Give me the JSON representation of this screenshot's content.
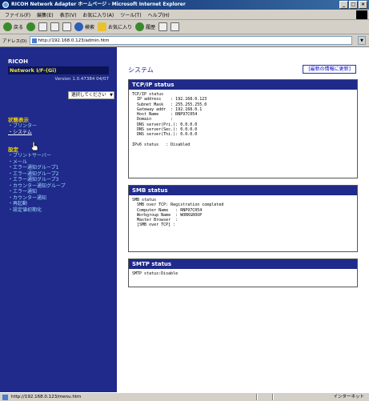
{
  "window": {
    "title": "RICOH Network Adapter ホームページ - Microsoft Internet Explorer"
  },
  "menu": [
    "ファイル(F)",
    "編集(E)",
    "表示(V)",
    "お気に入り(A)",
    "ツール(T)",
    "ヘルプ(H)"
  ],
  "toolbar": {
    "back": "戻る",
    "search": "検索",
    "favorites": "お気に入り",
    "history": "履歴"
  },
  "address": {
    "label": "アドレス(D)",
    "url": "http://192.168.0.123/admin.htm"
  },
  "sidebar": {
    "product": "RICOH",
    "network": "Network I/F-(Gi)",
    "version": "Version 1.0.47384 04/07",
    "select_label": "選択してください",
    "status_section": "状態表示",
    "status_links": [
      "・プリンター",
      "・システム"
    ],
    "settings_section": "設定",
    "settings_links": [
      "・プリントサーバー",
      "・メール",
      "・エラー通知グループ1",
      "・エラー通知グループ2",
      "・エラー通知グループ3",
      "・カウンター通知グループ",
      "・エラー通知",
      "・カウンター通知",
      "・再起動",
      "・設定値初期化"
    ]
  },
  "main": {
    "title": "システム",
    "refresh_button": "[最新の情報に更新]",
    "panels": [
      {
        "title": "TCP/IP status",
        "body": "TCP/IP status\n  IP address    : 192.168.0.123\n  Subnet Mask   : 255.255.255.0\n  Gateway addr  : 192.168.0.1\n  Host Name     : RNP97C054\n  Domain        :\n  DNS server(Pri.): 0.0.0.0\n  DNS server(Sec.): 0.0.0.0\n  DNS server(Thi.): 0.0.0.0\n\nIPv6 status   : Disabled"
      },
      {
        "title": "SMB status",
        "body": "SMB status\n  SMB over TCP: Registration completed\n  Computer Name   : RNP97C054\n  Workgroup Name  : WORKGROUP\n  Master Browser  :\n  [SMB over TCP] :"
      },
      {
        "title": "SMTP status",
        "body": "SMTP status:Disable"
      }
    ]
  },
  "status": {
    "text": "http://192.168.0.123/menu.htm",
    "zone": "インターネット"
  }
}
